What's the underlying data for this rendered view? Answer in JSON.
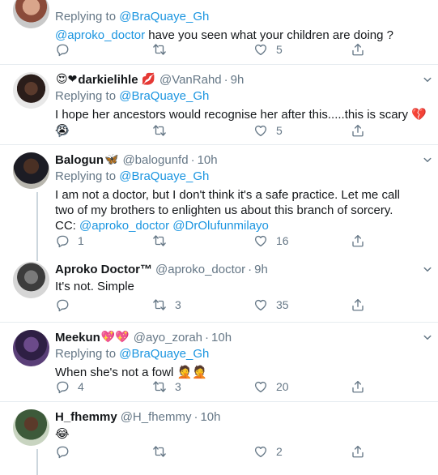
{
  "tweets": [
    {
      "name": "",
      "handle": "",
      "time": "",
      "replying_prefix": "Replying to",
      "replying_to": "@BraQuaye_Gh",
      "text_mention": "@aproko_doctor",
      "text": " have you seen what your children are doing ?",
      "reply_count": "",
      "retweet_count": "",
      "like_count": "5"
    },
    {
      "name_emoji_before": "😍❤",
      "name": "darkielihle",
      "name_emoji_after": "💋",
      "handle": "@VanRahd",
      "time": "9h",
      "replying_prefix": "Replying to",
      "replying_to": "@BraQuaye_Gh",
      "text": "I hope her ancestors would recognise her after this.....this is scary 💔😭",
      "reply_count": "",
      "retweet_count": "",
      "like_count": "5"
    },
    {
      "name": "Balogun",
      "name_emoji_after": "🦋",
      "handle": "@balogunfd",
      "time": "10h",
      "replying_prefix": "Replying to",
      "replying_to": "@BraQuaye_Gh",
      "text": "I am not a doctor, but I don't think it's a safe practice. Let me call two of my brothers to enlighten us about this branch of sorcery.",
      "cc_prefix": "CC: ",
      "cc_mentions": "@aproko_doctor @DrOlufunmilayo",
      "reply_count": "1",
      "retweet_count": "",
      "like_count": "16"
    },
    {
      "name": "Aproko Doctor™",
      "handle": "@aproko_doctor",
      "time": "9h",
      "text": "It's not. Simple",
      "reply_count": "",
      "retweet_count": "3",
      "like_count": "35"
    },
    {
      "name": "Meekun",
      "name_emoji_after": "💖💖",
      "handle": "@ayo_zorah",
      "time": "10h",
      "replying_prefix": "Replying to",
      "replying_to": "@BraQuaye_Gh",
      "text": "When she's not a fowl 🤦🤦",
      "reply_count": "4",
      "retweet_count": "3",
      "like_count": "20"
    },
    {
      "name": "H_fhemmy",
      "handle": "@H_fhemmy",
      "time": "10h",
      "text": "😂",
      "reply_count": "",
      "retweet_count": "",
      "like_count": "2"
    }
  ],
  "separator": "·",
  "colors": {
    "link": "#1b95e0",
    "muted": "#657786",
    "text": "#14171a",
    "divider": "#e6ecf0",
    "thread_line": "#ccd6dd"
  },
  "icons": [
    "reply-icon",
    "retweet-icon",
    "like-icon",
    "share-icon",
    "caret-down-icon"
  ]
}
